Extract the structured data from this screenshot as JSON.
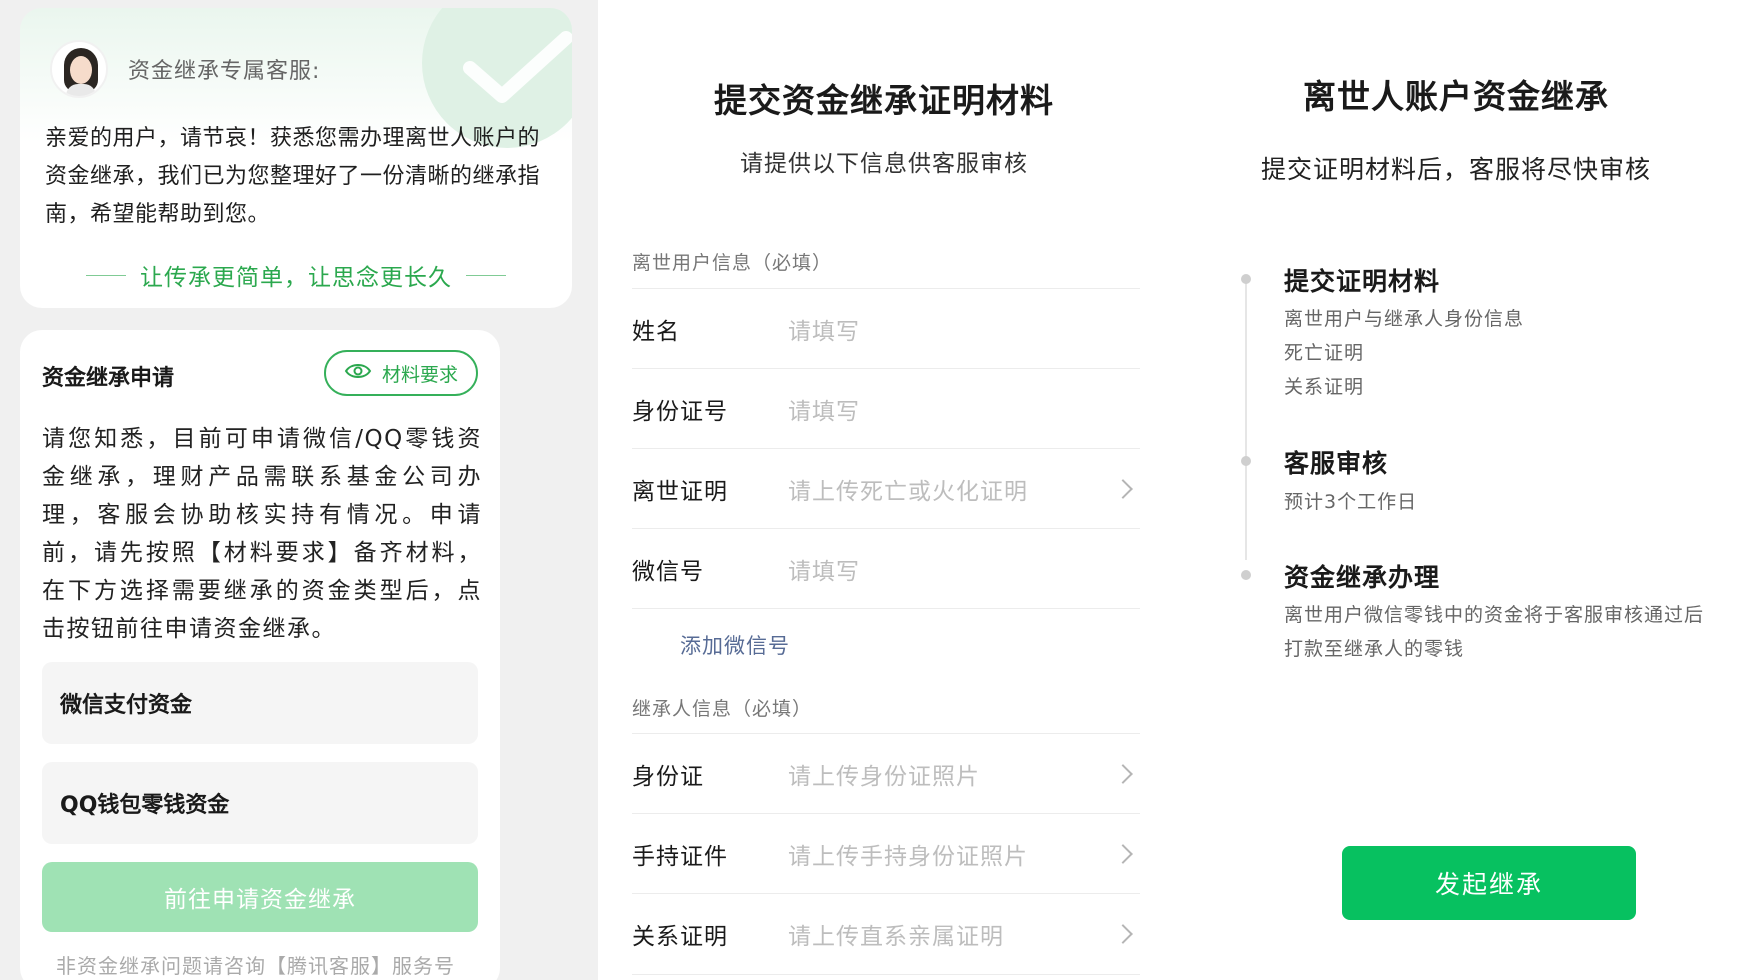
{
  "left": {
    "agent_label": "资金继承专属客服:",
    "intro": "亲爱的用户，请节哀！获悉您需办理离世人账户的资金继承，我们已为您整理好了一份清晰的继承指南，希望能帮助到您。",
    "slogan": "让传承更简单，让思念更长久",
    "apply_title": "资金继承申请",
    "requirements_button": "材料要求",
    "notice": "请您知悉，目前可申请微信/QQ零钱资金继承，理财产品需联系基金公司办理，客服会协助核实持有情况。申请前，请先按照【材料要求】备齐材料，在下方选择需要继承的资金类型后，点击按钮前往申请资金继承。",
    "options": [
      "微信支付资金",
      "QQ钱包零钱资金"
    ],
    "go_button": "前往申请资金继承",
    "footer_note": "非资金继承问题请咨询【腾讯客服】服务号"
  },
  "middle": {
    "title": "提交资金继承证明材料",
    "subtitle": "请提供以下信息供客服审核",
    "deceased_section": "离世用户信息（必填）",
    "deceased_fields": [
      {
        "label": "姓名",
        "placeholder": "请填写"
      },
      {
        "label": "身份证号",
        "placeholder": "请填写"
      },
      {
        "label": "离世证明",
        "placeholder": "请上传死亡或火化证明"
      },
      {
        "label": "微信号",
        "placeholder": "请填写"
      }
    ],
    "add_wechat": "添加微信号",
    "heir_section": "继承人信息（必填）",
    "heir_fields": [
      {
        "label": "身份证",
        "placeholder": "请上传身份证照片"
      },
      {
        "label": "手持证件",
        "placeholder": "请上传手持身份证照片"
      },
      {
        "label": "关系证明",
        "placeholder": "请上传直系亲属证明"
      }
    ]
  },
  "right": {
    "title": "离世人账户资金继承",
    "subtitle": "提交证明材料后，客服将尽快审核",
    "steps": [
      {
        "title": "提交证明材料",
        "lines": [
          "离世用户与继承人身份信息",
          "死亡证明",
          "关系证明"
        ]
      },
      {
        "title": "客服审核",
        "lines": [
          "预计3个工作日"
        ]
      },
      {
        "title": "资金继承办理",
        "lines": [
          "离世用户微信零钱中的资金将于客服审核通过后",
          "打款至继承人的零钱"
        ]
      }
    ],
    "start_button": "发起继承"
  },
  "colors": {
    "brand_green": "#07c160",
    "accent_green": "#2ba84e",
    "disabled_green": "#9fe2b4",
    "link_blue": "#576b95"
  }
}
